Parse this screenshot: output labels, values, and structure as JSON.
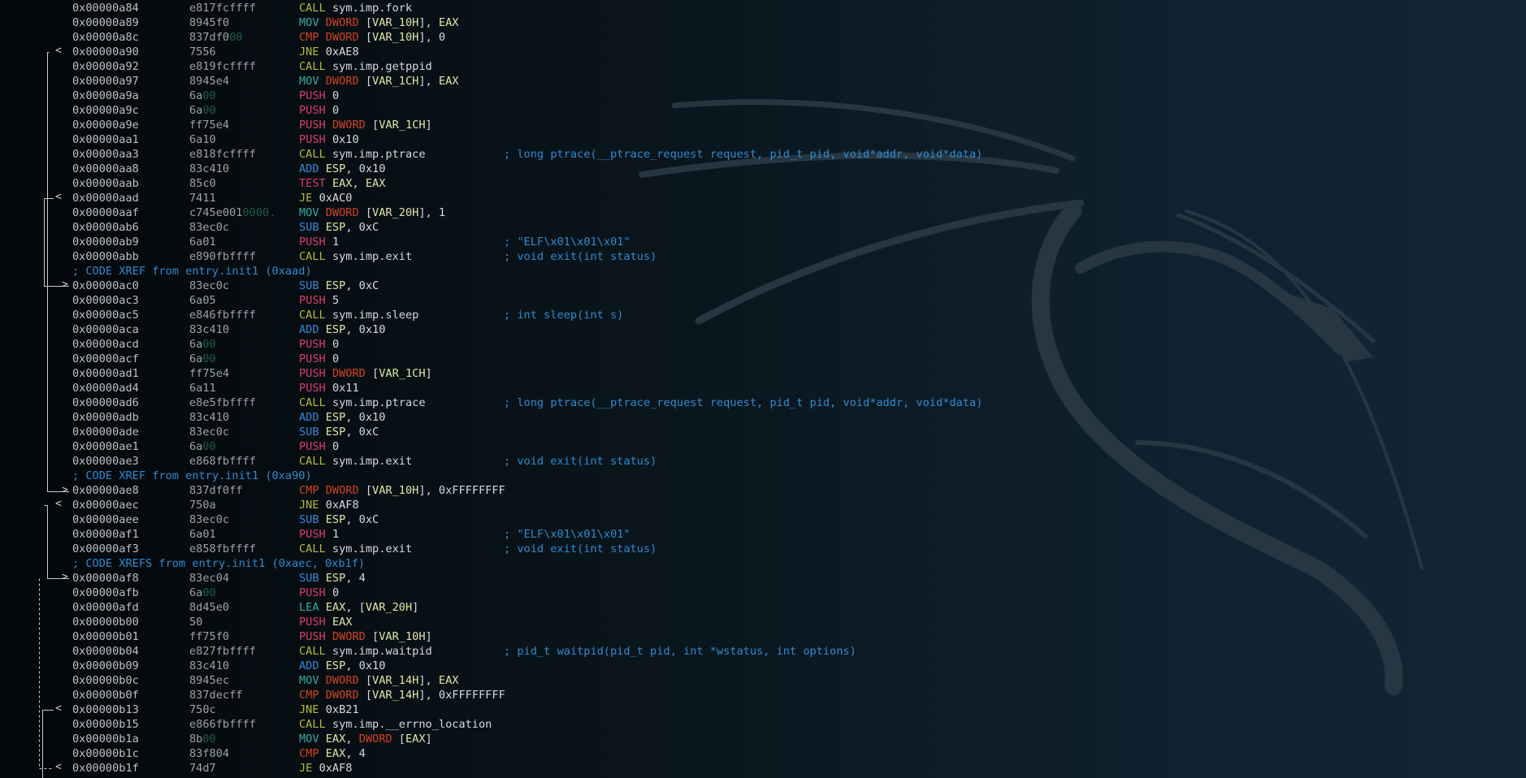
{
  "disassembly": [
    {
      "type": "insn",
      "addr": "0x00000a84",
      "bytes": [
        [
          "e817fcffff",
          false
        ]
      ],
      "mnemonic": "CALL",
      "mclass": "call",
      "operands": [
        [
          "sym.imp.fork",
          "op"
        ]
      ],
      "comment": ""
    },
    {
      "type": "insn",
      "addr": "0x00000a89",
      "bytes": [
        [
          "8945f0",
          false
        ]
      ],
      "mnemonic": "MOV",
      "mclass": "mov",
      "operands": [
        [
          "DWORD",
          "sz"
        ],
        [
          " [",
          "op"
        ],
        [
          "VAR_10H",
          "reg"
        ],
        [
          "], ",
          "op"
        ],
        [
          "EAX",
          "reg"
        ]
      ],
      "comment": ""
    },
    {
      "type": "insn",
      "addr": "0x00000a8c",
      "bytes": [
        [
          "837df0",
          false
        ],
        [
          "00",
          true
        ]
      ],
      "mnemonic": "CMP",
      "mclass": "cmp",
      "operands": [
        [
          "DWORD",
          "sz"
        ],
        [
          " [",
          "op"
        ],
        [
          "VAR_10H",
          "reg"
        ],
        [
          "], 0",
          "op"
        ]
      ],
      "comment": ""
    },
    {
      "type": "insn",
      "addr": "0x00000a90",
      "bytes": [
        [
          "7556",
          false
        ]
      ],
      "mnemonic": "JNE",
      "mclass": "jmp",
      "operands": [
        [
          "0xAE8",
          "op"
        ]
      ],
      "comment": ""
    },
    {
      "type": "insn",
      "addr": "0x00000a92",
      "bytes": [
        [
          "e819fcffff",
          false
        ]
      ],
      "mnemonic": "CALL",
      "mclass": "call",
      "operands": [
        [
          "sym.imp.getppid",
          "op"
        ]
      ],
      "comment": ""
    },
    {
      "type": "insn",
      "addr": "0x00000a97",
      "bytes": [
        [
          "8945e4",
          false
        ]
      ],
      "mnemonic": "MOV",
      "mclass": "mov",
      "operands": [
        [
          "DWORD",
          "sz"
        ],
        [
          " [",
          "op"
        ],
        [
          "VAR_1CH",
          "reg"
        ],
        [
          "], ",
          "op"
        ],
        [
          "EAX",
          "reg"
        ]
      ],
      "comment": ""
    },
    {
      "type": "insn",
      "addr": "0x00000a9a",
      "bytes": [
        [
          "6a",
          false
        ],
        [
          "00",
          true
        ]
      ],
      "mnemonic": "PUSH",
      "mclass": "push",
      "operands": [
        [
          "0",
          "op"
        ]
      ],
      "comment": ""
    },
    {
      "type": "insn",
      "addr": "0x00000a9c",
      "bytes": [
        [
          "6a",
          false
        ],
        [
          "00",
          true
        ]
      ],
      "mnemonic": "PUSH",
      "mclass": "push",
      "operands": [
        [
          "0",
          "op"
        ]
      ],
      "comment": ""
    },
    {
      "type": "insn",
      "addr": "0x00000a9e",
      "bytes": [
        [
          "ff75e4",
          false
        ]
      ],
      "mnemonic": "PUSH",
      "mclass": "push",
      "operands": [
        [
          "DWORD",
          "sz"
        ],
        [
          " [",
          "op"
        ],
        [
          "VAR_1CH",
          "reg"
        ],
        [
          "]",
          "op"
        ]
      ],
      "comment": ""
    },
    {
      "type": "insn",
      "addr": "0x00000aa1",
      "bytes": [
        [
          "6a10",
          false
        ]
      ],
      "mnemonic": "PUSH",
      "mclass": "push",
      "operands": [
        [
          "0x10",
          "op"
        ]
      ],
      "comment": ""
    },
    {
      "type": "insn",
      "addr": "0x00000aa3",
      "bytes": [
        [
          "e818fcffff",
          false
        ]
      ],
      "mnemonic": "CALL",
      "mclass": "call",
      "operands": [
        [
          "sym.imp.ptrace",
          "op"
        ]
      ],
      "comment": "; long ptrace(__ptrace_request request, pid_t pid, void*addr, void*data)"
    },
    {
      "type": "insn",
      "addr": "0x00000aa8",
      "bytes": [
        [
          "83c410",
          false
        ]
      ],
      "mnemonic": "ADD",
      "mclass": "add",
      "operands": [
        [
          "ESP",
          "reg"
        ],
        [
          ", 0x10",
          "op"
        ]
      ],
      "comment": ""
    },
    {
      "type": "insn",
      "addr": "0x00000aab",
      "bytes": [
        [
          "85c0",
          false
        ]
      ],
      "mnemonic": "TEST",
      "mclass": "test",
      "operands": [
        [
          "EAX",
          "reg"
        ],
        [
          ", ",
          "op"
        ],
        [
          "EAX",
          "reg"
        ]
      ],
      "comment": ""
    },
    {
      "type": "insn",
      "addr": "0x00000aad",
      "bytes": [
        [
          "7411",
          false
        ]
      ],
      "mnemonic": "JE",
      "mclass": "jmp",
      "operands": [
        [
          "0xAC0",
          "op"
        ]
      ],
      "comment": ""
    },
    {
      "type": "insn",
      "addr": "0x00000aaf",
      "bytes": [
        [
          "c745e001",
          false
        ],
        [
          "0000.",
          true
        ]
      ],
      "mnemonic": "MOV",
      "mclass": "mov",
      "operands": [
        [
          "DWORD",
          "sz"
        ],
        [
          " [",
          "op"
        ],
        [
          "VAR_20H",
          "reg"
        ],
        [
          "], 1",
          "op"
        ]
      ],
      "comment": ""
    },
    {
      "type": "insn",
      "addr": "0x00000ab6",
      "bytes": [
        [
          "83ec0c",
          false
        ]
      ],
      "mnemonic": "SUB",
      "mclass": "sub",
      "operands": [
        [
          "ESP",
          "reg"
        ],
        [
          ", 0xC",
          "op"
        ]
      ],
      "comment": ""
    },
    {
      "type": "insn",
      "addr": "0x00000ab9",
      "bytes": [
        [
          "6a01",
          false
        ]
      ],
      "mnemonic": "PUSH",
      "mclass": "push",
      "operands": [
        [
          "1",
          "op"
        ]
      ],
      "comment": "; \"ELF\\x01\\x01\\x01\""
    },
    {
      "type": "insn",
      "addr": "0x00000abb",
      "bytes": [
        [
          "e890fbffff",
          false
        ]
      ],
      "mnemonic": "CALL",
      "mclass": "call",
      "operands": [
        [
          "sym.imp.exit",
          "op"
        ]
      ],
      "comment": "; void exit(int status)"
    },
    {
      "type": "xref",
      "text": "; CODE XREF from entry.init1 (0xaad)"
    },
    {
      "type": "insn",
      "addr": "0x00000ac0",
      "bytes": [
        [
          "83ec0c",
          false
        ]
      ],
      "mnemonic": "SUB",
      "mclass": "sub",
      "operands": [
        [
          "ESP",
          "reg"
        ],
        [
          ", 0xC",
          "op"
        ]
      ],
      "comment": ""
    },
    {
      "type": "insn",
      "addr": "0x00000ac3",
      "bytes": [
        [
          "6a05",
          false
        ]
      ],
      "mnemonic": "PUSH",
      "mclass": "push",
      "operands": [
        [
          "5",
          "op"
        ]
      ],
      "comment": ""
    },
    {
      "type": "insn",
      "addr": "0x00000ac5",
      "bytes": [
        [
          "e846fbffff",
          false
        ]
      ],
      "mnemonic": "CALL",
      "mclass": "call",
      "operands": [
        [
          "sym.imp.sleep",
          "op"
        ]
      ],
      "comment": "; int sleep(int s)"
    },
    {
      "type": "insn",
      "addr": "0x00000aca",
      "bytes": [
        [
          "83c410",
          false
        ]
      ],
      "mnemonic": "ADD",
      "mclass": "add",
      "operands": [
        [
          "ESP",
          "reg"
        ],
        [
          ", 0x10",
          "op"
        ]
      ],
      "comment": ""
    },
    {
      "type": "insn",
      "addr": "0x00000acd",
      "bytes": [
        [
          "6a",
          false
        ],
        [
          "00",
          true
        ]
      ],
      "mnemonic": "PUSH",
      "mclass": "push",
      "operands": [
        [
          "0",
          "op"
        ]
      ],
      "comment": ""
    },
    {
      "type": "insn",
      "addr": "0x00000acf",
      "bytes": [
        [
          "6a",
          false
        ],
        [
          "00",
          true
        ]
      ],
      "mnemonic": "PUSH",
      "mclass": "push",
      "operands": [
        [
          "0",
          "op"
        ]
      ],
      "comment": ""
    },
    {
      "type": "insn",
      "addr": "0x00000ad1",
      "bytes": [
        [
          "ff75e4",
          false
        ]
      ],
      "mnemonic": "PUSH",
      "mclass": "push",
      "operands": [
        [
          "DWORD",
          "sz"
        ],
        [
          " [",
          "op"
        ],
        [
          "VAR_1CH",
          "reg"
        ],
        [
          "]",
          "op"
        ]
      ],
      "comment": ""
    },
    {
      "type": "insn",
      "addr": "0x00000ad4",
      "bytes": [
        [
          "6a11",
          false
        ]
      ],
      "mnemonic": "PUSH",
      "mclass": "push",
      "operands": [
        [
          "0x11",
          "op"
        ]
      ],
      "comment": ""
    },
    {
      "type": "insn",
      "addr": "0x00000ad6",
      "bytes": [
        [
          "e8e5fbffff",
          false
        ]
      ],
      "mnemonic": "CALL",
      "mclass": "call",
      "operands": [
        [
          "sym.imp.ptrace",
          "op"
        ]
      ],
      "comment": "; long ptrace(__ptrace_request request, pid_t pid, void*addr, void*data)"
    },
    {
      "type": "insn",
      "addr": "0x00000adb",
      "bytes": [
        [
          "83c410",
          false
        ]
      ],
      "mnemonic": "ADD",
      "mclass": "add",
      "operands": [
        [
          "ESP",
          "reg"
        ],
        [
          ", 0x10",
          "op"
        ]
      ],
      "comment": ""
    },
    {
      "type": "insn",
      "addr": "0x00000ade",
      "bytes": [
        [
          "83ec0c",
          false
        ]
      ],
      "mnemonic": "SUB",
      "mclass": "sub",
      "operands": [
        [
          "ESP",
          "reg"
        ],
        [
          ", 0xC",
          "op"
        ]
      ],
      "comment": ""
    },
    {
      "type": "insn",
      "addr": "0x00000ae1",
      "bytes": [
        [
          "6a",
          false
        ],
        [
          "00",
          true
        ]
      ],
      "mnemonic": "PUSH",
      "mclass": "push",
      "operands": [
        [
          "0",
          "op"
        ]
      ],
      "comment": ""
    },
    {
      "type": "insn",
      "addr": "0x00000ae3",
      "bytes": [
        [
          "e868fbffff",
          false
        ]
      ],
      "mnemonic": "CALL",
      "mclass": "call",
      "operands": [
        [
          "sym.imp.exit",
          "op"
        ]
      ],
      "comment": "; void exit(int status)"
    },
    {
      "type": "xref",
      "text": "; CODE XREF from entry.init1 (0xa90)"
    },
    {
      "type": "insn",
      "addr": "0x00000ae8",
      "bytes": [
        [
          "837df0ff",
          false
        ]
      ],
      "mnemonic": "CMP",
      "mclass": "cmp",
      "operands": [
        [
          "DWORD",
          "sz"
        ],
        [
          " [",
          "op"
        ],
        [
          "VAR_10H",
          "reg"
        ],
        [
          "], 0xFFFFFFFF",
          "op"
        ]
      ],
      "comment": ""
    },
    {
      "type": "insn",
      "addr": "0x00000aec",
      "bytes": [
        [
          "750a",
          false
        ]
      ],
      "mnemonic": "JNE",
      "mclass": "jmp",
      "operands": [
        [
          "0xAF8",
          "op"
        ]
      ],
      "comment": ""
    },
    {
      "type": "insn",
      "addr": "0x00000aee",
      "bytes": [
        [
          "83ec0c",
          false
        ]
      ],
      "mnemonic": "SUB",
      "mclass": "sub",
      "operands": [
        [
          "ESP",
          "reg"
        ],
        [
          ", 0xC",
          "op"
        ]
      ],
      "comment": ""
    },
    {
      "type": "insn",
      "addr": "0x00000af1",
      "bytes": [
        [
          "6a01",
          false
        ]
      ],
      "mnemonic": "PUSH",
      "mclass": "push",
      "operands": [
        [
          "1",
          "op"
        ]
      ],
      "comment": "; \"ELF\\x01\\x01\\x01\""
    },
    {
      "type": "insn",
      "addr": "0x00000af3",
      "bytes": [
        [
          "e858fbffff",
          false
        ]
      ],
      "mnemonic": "CALL",
      "mclass": "call",
      "operands": [
        [
          "sym.imp.exit",
          "op"
        ]
      ],
      "comment": "; void exit(int status)"
    },
    {
      "type": "xref",
      "text": "; CODE XREFS from entry.init1 (0xaec, 0xb1f)"
    },
    {
      "type": "insn",
      "addr": "0x00000af8",
      "bytes": [
        [
          "83ec04",
          false
        ]
      ],
      "mnemonic": "SUB",
      "mclass": "sub",
      "operands": [
        [
          "ESP",
          "reg"
        ],
        [
          ", 4",
          "op"
        ]
      ],
      "comment": ""
    },
    {
      "type": "insn",
      "addr": "0x00000afb",
      "bytes": [
        [
          "6a",
          false
        ],
        [
          "00",
          true
        ]
      ],
      "mnemonic": "PUSH",
      "mclass": "push",
      "operands": [
        [
          "0",
          "op"
        ]
      ],
      "comment": ""
    },
    {
      "type": "insn",
      "addr": "0x00000afd",
      "bytes": [
        [
          "8d45e0",
          false
        ]
      ],
      "mnemonic": "LEA",
      "mclass": "lea",
      "operands": [
        [
          "EAX",
          "reg"
        ],
        [
          ", [",
          "op"
        ],
        [
          "VAR_20H",
          "reg"
        ],
        [
          "]",
          "op"
        ]
      ],
      "comment": ""
    },
    {
      "type": "insn",
      "addr": "0x00000b00",
      "bytes": [
        [
          "50",
          false
        ]
      ],
      "mnemonic": "PUSH",
      "mclass": "push",
      "operands": [
        [
          "EAX",
          "reg"
        ]
      ],
      "comment": ""
    },
    {
      "type": "insn",
      "addr": "0x00000b01",
      "bytes": [
        [
          "ff75f0",
          false
        ]
      ],
      "mnemonic": "PUSH",
      "mclass": "push",
      "operands": [
        [
          "DWORD",
          "sz"
        ],
        [
          " [",
          "op"
        ],
        [
          "VAR_10H",
          "reg"
        ],
        [
          "]",
          "op"
        ]
      ],
      "comment": ""
    },
    {
      "type": "insn",
      "addr": "0x00000b04",
      "bytes": [
        [
          "e827fbffff",
          false
        ]
      ],
      "mnemonic": "CALL",
      "mclass": "call",
      "operands": [
        [
          "sym.imp.waitpid",
          "op"
        ]
      ],
      "comment": "; pid_t waitpid(pid_t pid, int *wstatus, int options)"
    },
    {
      "type": "insn",
      "addr": "0x00000b09",
      "bytes": [
        [
          "83c410",
          false
        ]
      ],
      "mnemonic": "ADD",
      "mclass": "add",
      "operands": [
        [
          "ESP",
          "reg"
        ],
        [
          ", 0x10",
          "op"
        ]
      ],
      "comment": ""
    },
    {
      "type": "insn",
      "addr": "0x00000b0c",
      "bytes": [
        [
          "8945ec",
          false
        ]
      ],
      "mnemonic": "MOV",
      "mclass": "mov",
      "operands": [
        [
          "DWORD",
          "sz"
        ],
        [
          " [",
          "op"
        ],
        [
          "VAR_14H",
          "reg"
        ],
        [
          "], ",
          "op"
        ],
        [
          "EAX",
          "reg"
        ]
      ],
      "comment": ""
    },
    {
      "type": "insn",
      "addr": "0x00000b0f",
      "bytes": [
        [
          "837decff",
          false
        ]
      ],
      "mnemonic": "CMP",
      "mclass": "cmp",
      "operands": [
        [
          "DWORD",
          "sz"
        ],
        [
          " [",
          "op"
        ],
        [
          "VAR_14H",
          "reg"
        ],
        [
          "], 0xFFFFFFFF",
          "op"
        ]
      ],
      "comment": ""
    },
    {
      "type": "insn",
      "addr": "0x00000b13",
      "bytes": [
        [
          "750c",
          false
        ]
      ],
      "mnemonic": "JNE",
      "mclass": "jmp",
      "operands": [
        [
          "0xB21",
          "op"
        ]
      ],
      "comment": ""
    },
    {
      "type": "insn",
      "addr": "0x00000b15",
      "bytes": [
        [
          "e866fbffff",
          false
        ]
      ],
      "mnemonic": "CALL",
      "mclass": "call",
      "operands": [
        [
          "sym.imp.__errno_location",
          "op"
        ]
      ],
      "comment": ""
    },
    {
      "type": "insn",
      "addr": "0x00000b1a",
      "bytes": [
        [
          "8b",
          false
        ],
        [
          "00",
          true
        ]
      ],
      "mnemonic": "MOV",
      "mclass": "mov",
      "operands": [
        [
          "EAX",
          "reg"
        ],
        [
          ", ",
          "op"
        ],
        [
          "DWORD",
          "sz"
        ],
        [
          " [",
          "op"
        ],
        [
          "EAX",
          "reg"
        ],
        [
          "]",
          "op"
        ]
      ],
      "comment": ""
    },
    {
      "type": "insn",
      "addr": "0x00000b1c",
      "bytes": [
        [
          "83f804",
          false
        ]
      ],
      "mnemonic": "CMP",
      "mclass": "cmp",
      "operands": [
        [
          "EAX",
          "reg"
        ],
        [
          ", 4",
          "op"
        ]
      ],
      "comment": ""
    },
    {
      "type": "insn",
      "addr": "0x00000b1f",
      "bytes": [
        [
          "74d7",
          false
        ]
      ],
      "mnemonic": "JE",
      "mclass": "jmp",
      "operands": [
        [
          "0xAF8",
          "op"
        ]
      ],
      "comment": ""
    }
  ],
  "arrow_glyphs": {
    "out": "<",
    "in": ">"
  },
  "colors": {
    "background": "#0a141b",
    "address": "#bcc1c7",
    "comment": "#2f8bd1",
    "call": "#b7b832",
    "mov": "#35a9a4",
    "cmp": "#d4421f",
    "push": "#dc3c6a",
    "add_sub": "#3a88d6",
    "register": "#e4e4a6"
  },
  "background_art": "kali-dragon-logo"
}
